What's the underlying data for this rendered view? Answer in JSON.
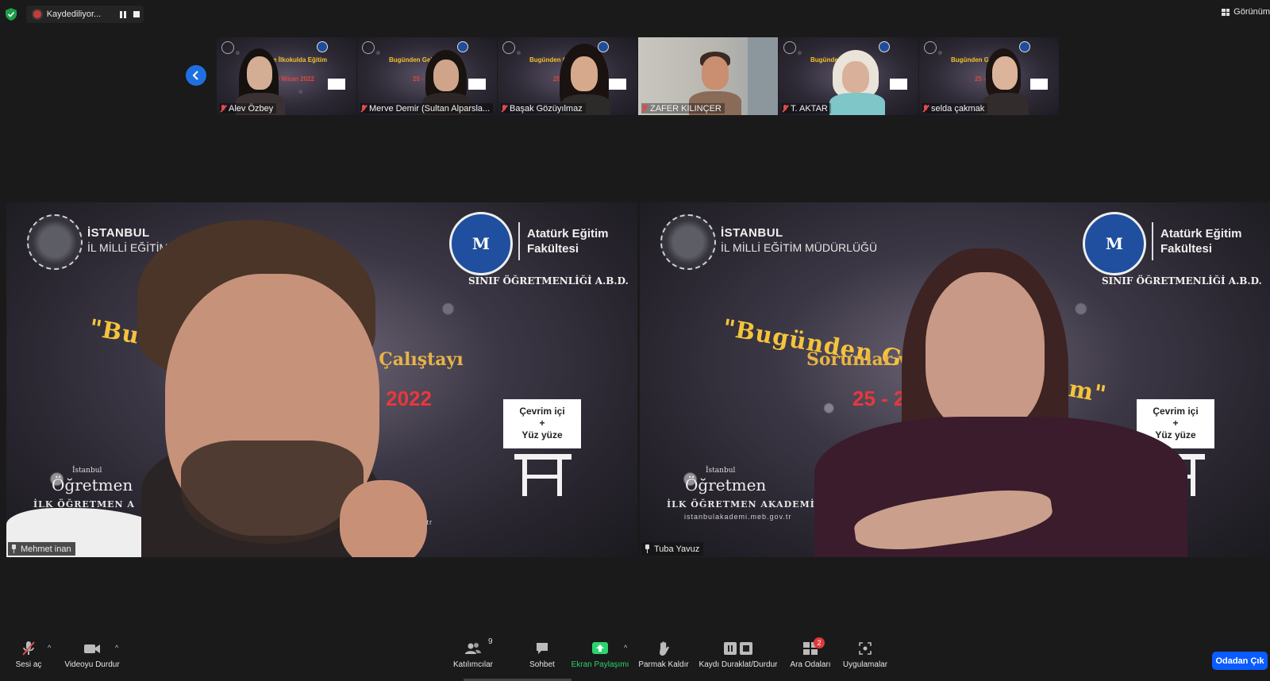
{
  "topbar": {
    "recording_label": "Kaydediliyor...",
    "view_label": "Görünüm"
  },
  "gallery": {
    "thumbnails": [
      {
        "name": "Alev Özbey",
        "slide_title": "Geleceğe İlkokulda Eğitim",
        "slide_date": "20 Nisan 2022"
      },
      {
        "name": "Merve Demir (Sultan Alparsla...",
        "slide_title": "Bugünden Geleceğe",
        "slide_date": "25 - 26"
      },
      {
        "name": "Başak Gözüyılmaz",
        "slide_title": "Bugünden Gelec",
        "slide_date": "25"
      },
      {
        "name": "ZAFER KILINÇER",
        "slide_title": "",
        "slide_date": ""
      },
      {
        "name": "T. AKTAR",
        "slide_title": "Bugünden Gel",
        "slide_date": "25"
      },
      {
        "name": "selda çakmak",
        "slide_title": "Bugünden Gel",
        "slide_date": "25 - 26"
      }
    ]
  },
  "tiles": [
    {
      "name": "Mehmet inan",
      "meb_line1": "İSTANBUL",
      "meb_line2": "İL MİLLİ EĞİTİM M",
      "faculty_line1": "Atatürk Eğitim",
      "faculty_line2": "Fakültesi",
      "department": "SINIF ÖĞRETMENLİĞİ A.B.D.",
      "title": "\"Bu                         lkokulda Eğitim\"",
      "subtitle": "r Çalıştayı",
      "date": "n 2022",
      "board_line1": "Çevrim içi",
      "board_line2": "+",
      "board_line3": "Yüz yüze",
      "academy_small": "İstanbul",
      "academy_big": "Öğretmen",
      "academy_line": "İLK ÖĞRETMEN A",
      "academy_url": "u.tr"
    },
    {
      "name": "Tuba Yavuz",
      "meb_line1": "İSTANBUL",
      "meb_line2": "İL MİLLİ EĞİTİM MÜDÜRLÜĞÜ",
      "faculty_line1": "Atatürk Eğitim",
      "faculty_line2": "Fakültesi",
      "department": "SINIF ÖĞRETMENLİĞİ A.B.D.",
      "title": "\"Bugünden Gelece              a Eğitim\"",
      "subtitle": "Sorunlar ve Ç",
      "date": "25 - 2",
      "board_line1": "Çevrim içi",
      "board_line2": "+",
      "board_line3": "Yüz yüze",
      "academy_small": "İstanbul",
      "academy_big": "Öğretmen",
      "academy_line": "İLK ÖĞRETMEN AKADEMİSİ",
      "academy_url": "istanbulakademi.meb.gov.tr"
    }
  ],
  "toolbar": {
    "unmute": "Sesi aç",
    "stop_video": "Videoyu Durdur",
    "participants": "Katılımcılar",
    "participants_count": "9",
    "chat": "Sohbet",
    "share_screen": "Ekran Paylaşımı",
    "raise_hand": "Parmak Kaldır",
    "pause_recording": "Kaydı Duraklat/Durdur",
    "breakout_rooms": "Ara Odaları",
    "breakout_badge": "2",
    "apps": "Uygulamalar",
    "leave": "Odadan Çık",
    "share_color": "#2bd46f",
    "leave_color": "#0b5cff"
  }
}
